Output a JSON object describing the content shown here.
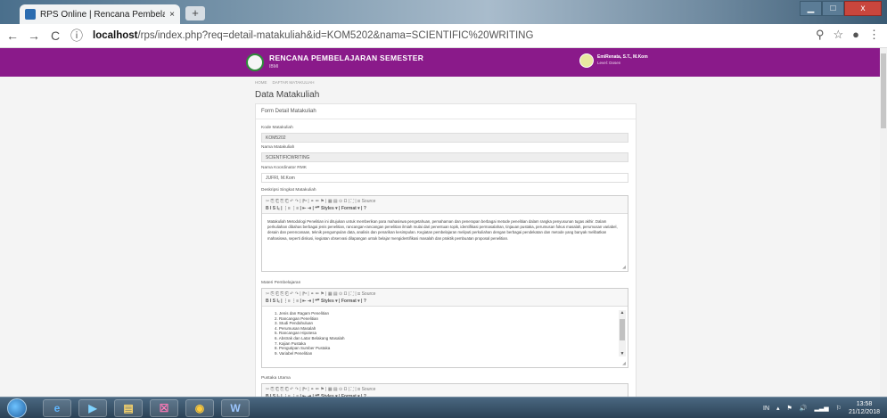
{
  "browser": {
    "tab_title": "RPS Online | Rencana Pembelaja",
    "tab_close": "×",
    "new_tab": "+",
    "url_host": "localhost",
    "url_path": "/rps/index.php?req=detail-matakuliah&id=KOM5202&nama=SCIENTIFIC%20WRITING",
    "url_icon": "ⓘ",
    "back": "←",
    "forward": "→",
    "reload": "C",
    "win_min": "▁",
    "win_max": "□",
    "win_close": "x"
  },
  "header": {
    "title": "RENCANA PEMBELAJARAN SEMESTER",
    "subtitle": "IBMI",
    "user_name": "EmiRenata, S.T., M.Kom",
    "user_level": "Level: Dosen"
  },
  "breadcrumb": [
    "HOME",
    "DAFTAR MATAKULIAH"
  ],
  "page_title": "Data Matakuliah",
  "form": {
    "header": "Form Detail Matakuliah",
    "kode_label": "Kode Matakuliah",
    "kode_value": "KOM5202",
    "nama_label": "Nama Matakuliah",
    "nama_value": "SCIENTIFICWRITING",
    "koordinator_label": "Nama Koordinator RMK",
    "koordinator_value": "JUFRI, M.Kom",
    "deskripsi_label": "Deskripsi Singkat Matakuliah",
    "deskripsi_text": "Matakuliah Metodologi Penelitian ini ditujukan untuk memberikan para mahasiswa pengetahuan, pemahaman dan penerapan berbagai metode penelitian dalam rangka penyusunan tugas akhir. Dalam perkuliahan dibahas berbagai jenis penelitian, rancangan-rancangan penelitian ilmiah mulai dari penentuan topik, identifikasi permasalahan, tinjauan pustaka, perumusan fokus masalah, perumusan variabel, desain dan perencanaan, teknik pengumpulan data, analisis dan penarikan kesimpulan. Kegiatan pembelajaran meliputi perkuliahan dengan berbagai pendekatan dan metode yang banyak melibatkan mahasiswa, seperti diskusi, kegiatan observasi dilapangan untuk belajar mengidentifikasi masalah dan praktik pembuatan proposal penelitian.",
    "materi_label": "Materi Pembelajaran",
    "materi_items": [
      "1. Jenis dan Ragam Penelitian",
      "2. Rancangan Penelitian",
      "3. Studi Pendahuluan",
      "4. Perumusan Masalah",
      "5. Rancangan Hipotesa",
      "6. Abstrak dan Latar Belakang Masalah",
      "7. Kajian Pustaka",
      "8. Pengutipan Sumber Pustaka",
      "9. Variabel Penelitian"
    ],
    "pustaka_label": "Pustaka Utama"
  },
  "toolbar": {
    "row1": "✂ ⎘ ⎗ ⎘ ⎗ ↶ ↷ | ⁋ᵃ | ⚭ ⚮ ⚑ | ▦ ▤ ⊙ Ω | ⛶ | ⊡ Source",
    "row2": "B  I  S  Iₓ | ⋮≡ ⋮≡ | ⇤ ⇥ | ❝❞  Styles  ▾ | Format  ▾ | ?"
  },
  "taskbar": {
    "lang": "IN",
    "time": "13:58",
    "date": "21/12/2018",
    "apps": [
      "e",
      "▶",
      "▤",
      "☒",
      "◉",
      "W"
    ]
  }
}
